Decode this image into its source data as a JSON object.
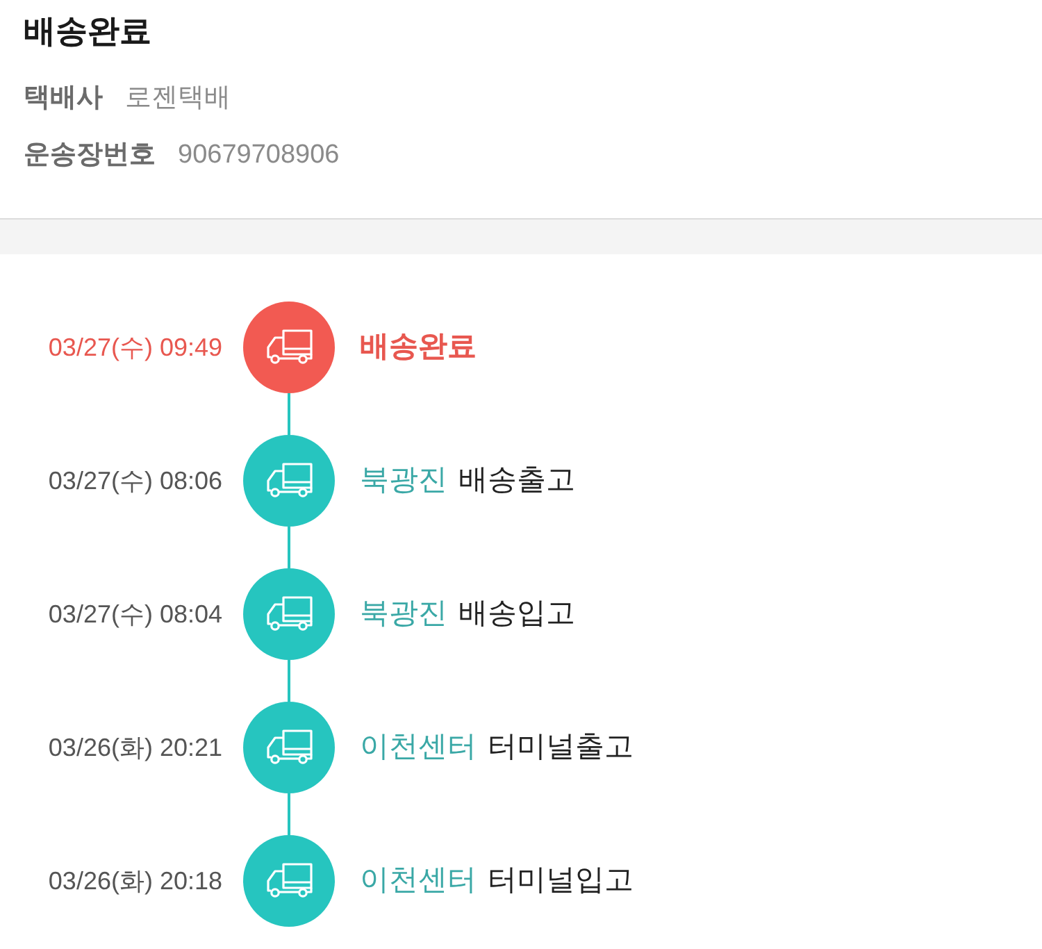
{
  "header": {
    "title": "배송완료",
    "carrier": {
      "label": "택배사",
      "value": "로젠택배"
    },
    "tracking": {
      "label": "운송장번호",
      "value": "90679708906"
    }
  },
  "events": [
    {
      "time": "03/27(수) 09:49",
      "status": "배송완료",
      "current": true
    },
    {
      "time": "03/27(수) 08:06",
      "location": "북광진",
      "status": "배송출고",
      "current": false
    },
    {
      "time": "03/27(수) 08:04",
      "location": "북광진",
      "status": "배송입고",
      "current": false
    },
    {
      "time": "03/26(화) 20:21",
      "location": "이천센터",
      "status": "터미널출고",
      "current": false
    },
    {
      "time": "03/26(화) 20:18",
      "location": "이천센터",
      "status": "터미널입고",
      "current": false
    }
  ]
}
